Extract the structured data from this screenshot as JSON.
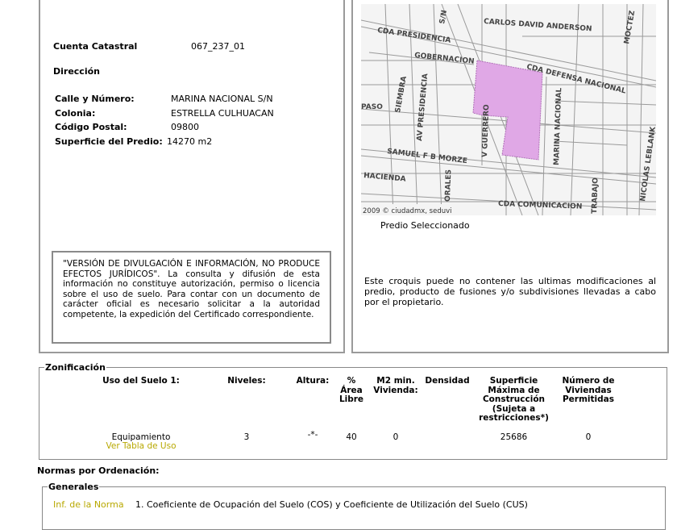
{
  "predio": {
    "cuenta_label": "Cuenta Catastral",
    "cuenta_value": "067_237_01",
    "direccion_label": "Dirección",
    "fields": [
      {
        "label": "Calle y Número:",
        "value": "MARINA NACIONAL S/N"
      },
      {
        "label": "Colonia:",
        "value": "ESTRELLA CULHUACAN"
      },
      {
        "label": "Código Postal:",
        "value": "09800"
      },
      {
        "label": "Superficie del Predio:",
        "value": "14270 m2"
      }
    ],
    "disclaimer": "\"VERSIÓN DE DIVULGACIÓN E INFORMACIÓN, NO PRODUCE EFECTOS JURÍDICOS\". La consulta y difusión de esta información no constituye autorización, permiso o licencia sobre el uso de suelo. Para contar con un documento de carácter oficial es necesario solicitar a la autoridad competente, la expedición del Certificado correspondiente."
  },
  "map": {
    "streets": [
      "CARLOS DAVID ANDERSON",
      "CDA PRESIDENCIA",
      "GOBERNACION",
      "CDA DEFENSA NACIONAL",
      "SIEMBRA",
      "AV PRESIDENCIA",
      "PASO",
      "V GUERRERO",
      "MARINA NACIONAL",
      "NICOLAS LEBLANK",
      "SAMUEL F B MORZE",
      "HACIENDA",
      "ORALES",
      "CDA COMUNICACION",
      "TRABAJO",
      "MOCTEZ",
      "S/N"
    ],
    "copyright": "2009 © ciudadmx, seduvi",
    "caption": "Predio Seleccionado",
    "highlight_color": "#e0a8e6",
    "note": "Este croquis puede no contener las ultimas modificaciones al predio, producto de fusiones y/o subdivisiones llevadas a cabo por el propietario."
  },
  "zonificacion": {
    "legend": "Zonificación",
    "headers": [
      "Uso del Suelo 1:",
      "Niveles:",
      "Altura:",
      "% Área Libre",
      "M2 min. Vivienda:",
      "Densidad",
      "Superficie Máxima de Construcción (Sujeta a restricciones*)",
      "Número de Viviendas Permitidas"
    ],
    "row": {
      "uso": "Equipamiento",
      "link": "Ver Tabla de Uso",
      "niveles": "3",
      "altura": "-*-",
      "area_libre": "40",
      "m2_min": "0",
      "densidad": "",
      "superficie": "25686",
      "viviendas": "0"
    }
  },
  "normas": {
    "title": "Normas por Ordenación:",
    "generales_legend": "Generales",
    "items": [
      {
        "link": "Inf. de la Norma",
        "text": "1. Coeficiente de Ocupación del Suelo (COS) y Coeficiente de Utilización del Suelo (CUS)"
      }
    ]
  }
}
